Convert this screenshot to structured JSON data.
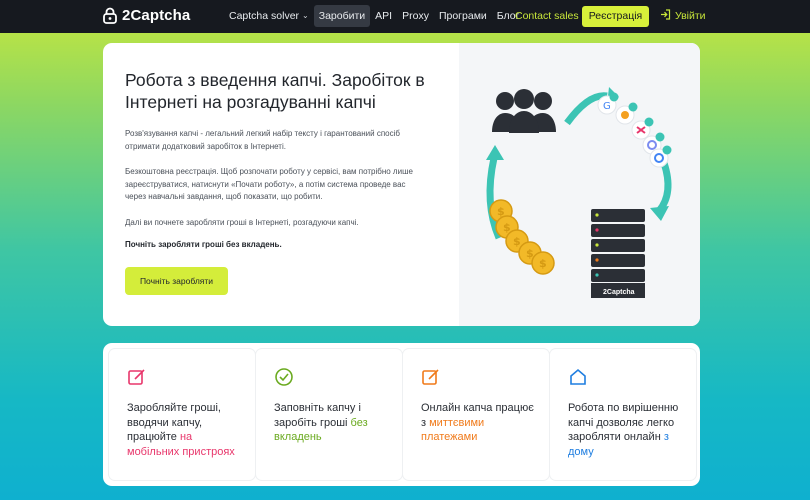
{
  "header": {
    "brand": "2Captcha",
    "nav": [
      {
        "label": "Captcha solver",
        "has_dropdown": true,
        "active": false
      },
      {
        "label": "Заробити",
        "active": true
      },
      {
        "label": "API",
        "active": false
      },
      {
        "label": "Proxy",
        "active": false
      },
      {
        "label": "Програми",
        "active": false
      },
      {
        "label": "Блог",
        "active": false
      }
    ],
    "contact_label": "Contact sales",
    "register_label": "Реєстрація",
    "login_label": "Увійти"
  },
  "hero": {
    "title": "Робота з введення капчі. Заробіток в Інтернеті на розгадуванні капчі",
    "p1": "Розв'язування капчі - легальний легкий набір тексту і гарантований спосіб отримати додатковий заробіток в Інтернеті.",
    "p2": "Безкоштовна реєстрація. Щоб розпочати роботу у сервісі, вам потрібно лише зареєструватися, натиснути «Почати роботу», а потім система проведе вас через навчальні завдання, щоб показати, що робити.",
    "p3": "Далі ви почнете заробляти гроші в Інтернеті, розгадуючи капчі.",
    "p4": "Почніть заробляти гроші без вкладень.",
    "cta_label": "Почніть заробляти",
    "server_label": "2Captcha"
  },
  "features": [
    {
      "icon": "edit-icon",
      "color": "#e8366b",
      "text": "Заробляйте гроші, вводячи капчу, працюйте ",
      "highlight": "на мобільних пристроях",
      "highlight_class": "hl-pink"
    },
    {
      "icon": "check-circle-icon",
      "color": "#6aaa1f",
      "text": "Заповніть капчу і заробіть гроші ",
      "highlight": "без вкладень",
      "highlight_class": "hl-green"
    },
    {
      "icon": "edit-icon",
      "color": "#f07a1a",
      "text": "Онлайн капча працює з ",
      "highlight": "миттєвими платежами",
      "highlight_class": "hl-orange"
    },
    {
      "icon": "home-icon",
      "color": "#1f7ee0",
      "text": "Робота по вирішенню капчі дозволяє легко заробляти онлайн ",
      "highlight": "з дому",
      "highlight_class": "hl-blue"
    }
  ],
  "colors": {
    "accent": "#d8f03a",
    "dark": "#16191f",
    "teal": "#3cc4b4"
  }
}
